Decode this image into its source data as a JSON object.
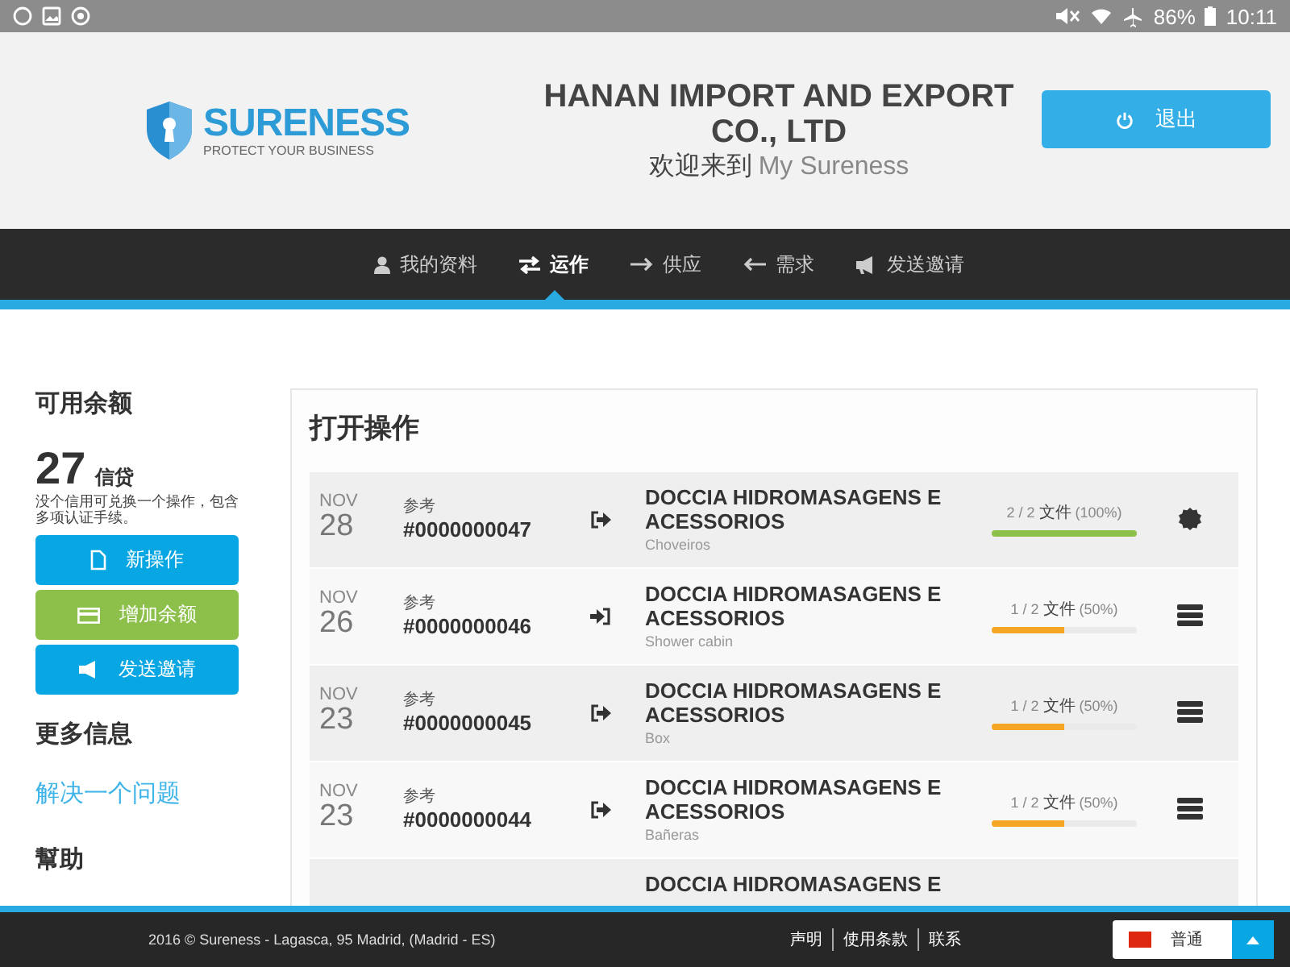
{
  "status_bar": {
    "battery": "86%",
    "time": "10:11"
  },
  "header": {
    "logo": {
      "name": "SURENESS",
      "tagline": "PROTECT YOUR BUSINESS"
    },
    "company": "HANAN IMPORT AND EXPORT CO., LTD",
    "welcome": "欢迎来到",
    "welcome_site": "My Sureness",
    "logout_button": "退出"
  },
  "nav": [
    {
      "label": "我的资料",
      "kind": "profile",
      "selected": false
    },
    {
      "label": "运作",
      "kind": "operations",
      "selected": true
    },
    {
      "label": "供应",
      "kind": "supply",
      "selected": false
    },
    {
      "label": "需求",
      "kind": "demand",
      "selected": false
    },
    {
      "label": "发送邀请",
      "kind": "invite",
      "selected": false
    }
  ],
  "sidebar": {
    "balance_title": "可用余额",
    "credits": "27",
    "credits_unit": "信贷",
    "credits_note": "没个信用可兑换一个操作，包含多项认证手续。",
    "buttons": [
      {
        "label": "新操作",
        "kind": "new"
      },
      {
        "label": "增加余额",
        "kind": "topup"
      },
      {
        "label": "发送邀请",
        "kind": "invite"
      }
    ],
    "more_title": "更多信息",
    "link": "解决一个问题",
    "help_title": "幫助"
  },
  "operations": {
    "title": "打开操作",
    "rows": [
      {
        "month": "NOV",
        "day": "28",
        "ref_label": "参考",
        "ref": "#0000000047",
        "kind": "outgoing",
        "title": "DOCCIA HIDROMASAGENS E ACESSORIOS",
        "category": "Choveiros",
        "files": "2 / 2",
        "files_label": "文件",
        "percent": "(100%)",
        "level": 1
      },
      {
        "month": "NOV",
        "day": "26",
        "ref_label": "参考",
        "ref": "#0000000046",
        "kind": "incoming",
        "title": "DOCCIA HIDROMASAGENS E ACESSORIOS",
        "category": "Shower cabin",
        "files": "1 / 2",
        "files_label": "文件",
        "percent": "(50%)",
        "level": 0.5
      },
      {
        "month": "NOV",
        "day": "23",
        "ref_label": "参考",
        "ref": "#0000000045",
        "kind": "outgoing",
        "title": "DOCCIA HIDROMASAGENS E ACESSORIOS",
        "category": "Box",
        "files": "1 / 2",
        "files_label": "文件",
        "percent": "(50%)",
        "level": 0.5
      },
      {
        "month": "NOV",
        "day": "23",
        "ref_label": "参考",
        "ref": "#0000000044",
        "kind": "outgoing",
        "title": "DOCCIA HIDROMASAGENS E ACESSORIOS",
        "category": "Bañeras",
        "files": "1 / 2",
        "files_label": "文件",
        "percent": "(50%)",
        "level": 0.5
      },
      {
        "title": "DOCCIA HIDROMASAGENS E"
      }
    ]
  },
  "footer": {
    "copyright": "2016 © Sureness - Lagasca, 95 Madrid, (Madrid - ES)",
    "links": [
      "声明",
      "使用条款",
      "联系"
    ],
    "language": "普通"
  }
}
